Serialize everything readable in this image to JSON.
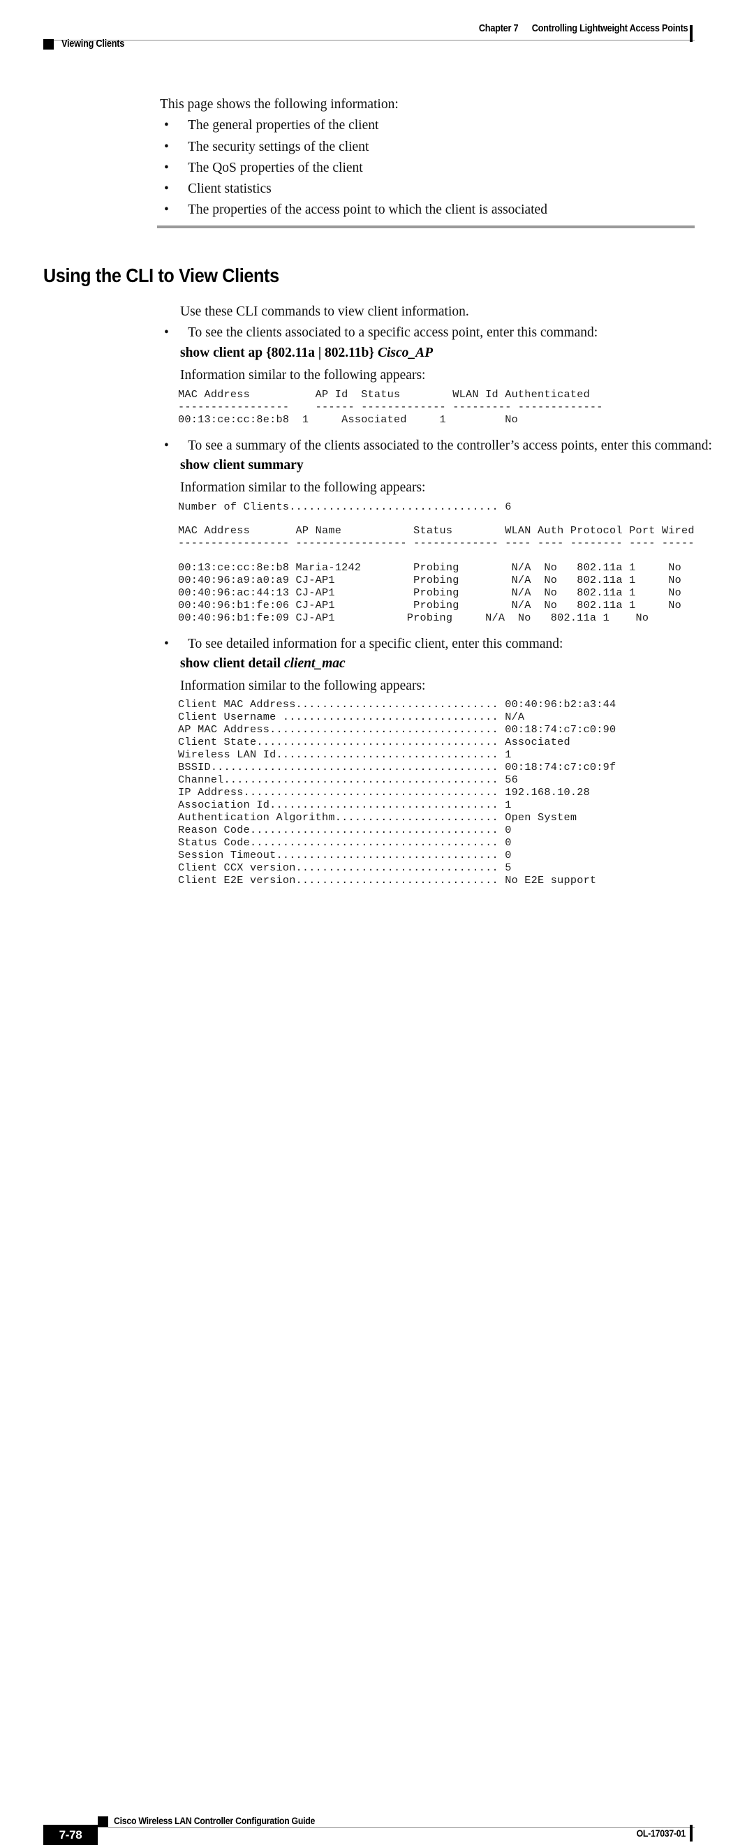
{
  "header": {
    "chapter_number": "Chapter 7",
    "chapter_title": "Controlling Lightweight Access Points",
    "section_title": "Viewing Clients"
  },
  "intro": {
    "lead": "This page shows the following information:",
    "bullets": [
      "The general properties of the client",
      "The security settings of the client",
      "The QoS properties of the client",
      "Client statistics",
      "The properties of the access point to which the client is associated"
    ],
    "bullet_glyph": "•"
  },
  "section": {
    "heading": "Using the CLI to View Clients",
    "lead": "Use these CLI commands to view client information."
  },
  "commands": [
    {
      "bullet": "To see the clients associated to a specific access point, enter this command:",
      "syntax_bold": "show client ap",
      "syntax_braces": "{802.11a | 802.11b}",
      "syntax_italic": "Cisco_AP",
      "result_label": "Information similar to the following appears:",
      "output": "MAC Address          AP Id  Status        WLAN Id Authenticated\n-----------------    ------ ------------- --------- -------------\n00:13:ce:cc:8e:b8  1     Associated     1         No"
    },
    {
      "bullet": "To see a summary of the clients associated to the controller’s access points, enter this command:",
      "syntax_bold": "show client summary",
      "syntax_braces": "",
      "syntax_italic": "",
      "result_label": "Information similar to the following appears:",
      "output_count": "Number of Clients................................ 6",
      "output_header": "MAC Address       AP Name           Status        WLAN Auth Protocol Port Wired\n----------------- ----------------- ------------- ---- ---- -------- ---- -----",
      "output_rows": [
        "00:13:ce:cc:8e:b8 Maria-1242        Probing        N/A  No   802.11a 1     No",
        "00:40:96:a9:a0:a9 CJ-AP1            Probing        N/A  No   802.11a 1     No",
        "00:40:96:ac:44:13 CJ-AP1            Probing        N/A  No   802.11a 1     No",
        "00:40:96:b1:fe:06 CJ-AP1            Probing        N/A  No   802.11a 1     No",
        "00:40:96:b1:fe:09 CJ-AP1           Probing     N/A  No   802.11a 1    No"
      ]
    },
    {
      "bullet": "To see detailed information for a specific client, enter this command:",
      "syntax_bold": "show client detail",
      "syntax_braces": "",
      "syntax_italic": "client_mac",
      "result_label": "Information similar to the following appears:",
      "detail_lines": [
        "Client MAC Address............................... 00:40:96:b2:a3:44",
        "Client Username ................................. N/A",
        "AP MAC Address................................... 00:18:74:c7:c0:90",
        "Client State..................................... Associated",
        "Wireless LAN Id.................................. 1",
        "BSSID............................................ 00:18:74:c7:c0:9f",
        "Channel.......................................... 56",
        "IP Address....................................... 192.168.10.28",
        "Association Id................................... 1",
        "Authentication Algorithm......................... Open System",
        "Reason Code...................................... 0",
        "Status Code...................................... 0",
        "Session Timeout.................................. 0",
        "Client CCX version............................... 5",
        "Client E2E version............................... No E2E support"
      ]
    }
  ],
  "footer": {
    "page_number": "7-78",
    "guide_title": "Cisco Wireless LAN Controller Configuration Guide",
    "doc_id": "OL-17037-01"
  }
}
